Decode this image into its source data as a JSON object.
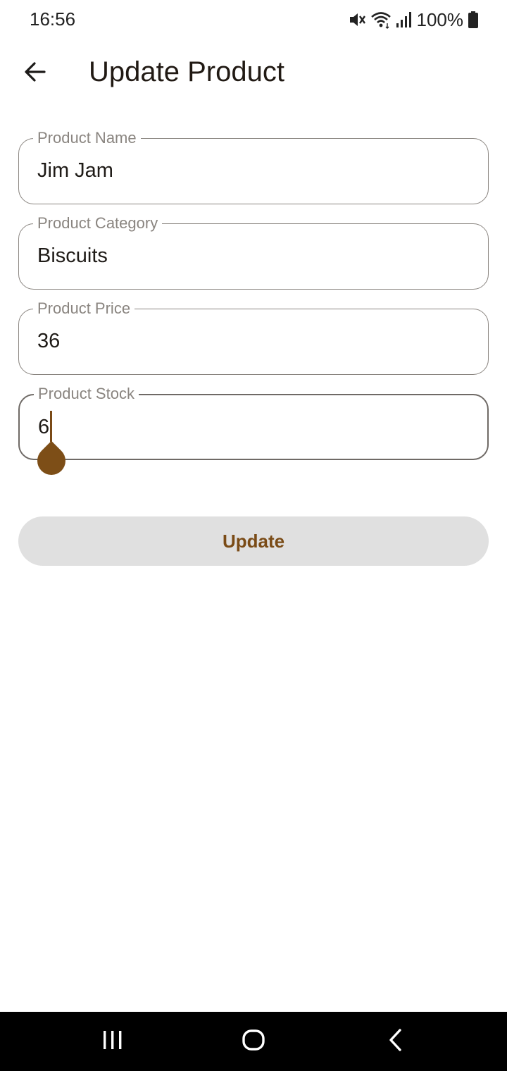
{
  "status_bar": {
    "time": "16:56",
    "battery_percent": "100%",
    "icons": [
      "mute-icon",
      "wifi-icon",
      "signal-icon",
      "battery-icon"
    ]
  },
  "app_bar": {
    "title": "Update Product",
    "back_icon": "arrow-back-icon"
  },
  "form": {
    "fields": [
      {
        "label": "Product Name",
        "value": "Jim Jam"
      },
      {
        "label": "Product Category",
        "value": "Biscuits"
      },
      {
        "label": "Product Price",
        "value": "36"
      },
      {
        "label": "Product Stock",
        "value": "6",
        "focused": true
      }
    ],
    "submit_label": "Update"
  },
  "nav_bar": {
    "icons": [
      "recents-icon",
      "home-icon",
      "back-icon"
    ]
  },
  "colors": {
    "accent": "#7a4b16",
    "button_bg": "#e0e0e0",
    "outline": "#8a8580"
  }
}
